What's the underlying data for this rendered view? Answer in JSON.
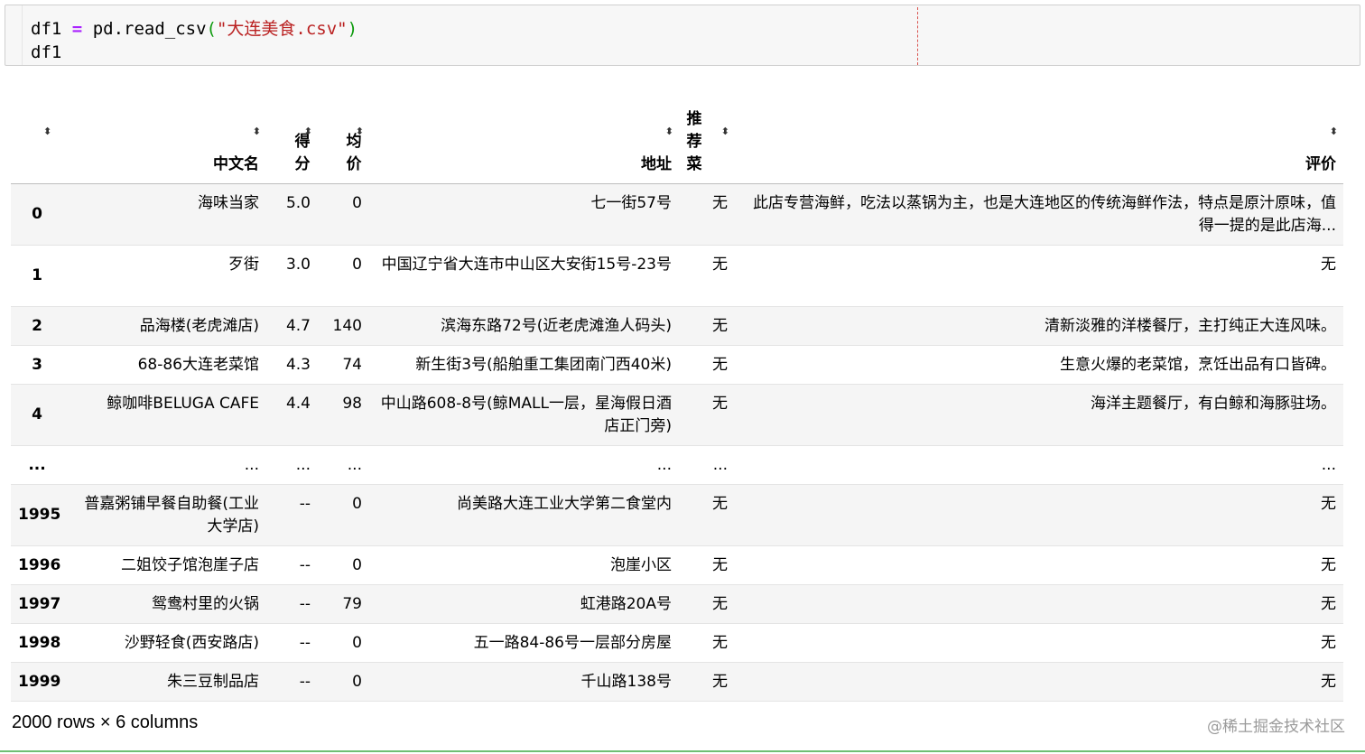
{
  "code_cell": {
    "line1": {
      "var": "df1",
      "eq": "=",
      "call": "pd.read_csv",
      "open": "(",
      "arg": "\"大连美食.csv\"",
      "close": ")"
    },
    "line2": "df1"
  },
  "table": {
    "headers": {
      "name": "中文名",
      "score": [
        "得",
        "分"
      ],
      "price": [
        "均",
        "价"
      ],
      "address": "地址",
      "recommend": [
        "推",
        "荐",
        "菜"
      ],
      "review": "评价"
    },
    "sort_icon": "⬍",
    "rows": [
      {
        "index": "0",
        "name": "海味当家",
        "score": "5.0",
        "price": "0",
        "address": "七一街57号",
        "recommend": "无",
        "review": "此店专营海鲜，吃法以蒸锅为主，也是大连地区的传统海鲜作法，特点是原汁原味，值得一提的是此店海..."
      },
      {
        "index": "1",
        "name": "歹街",
        "score": "3.0",
        "price": "0",
        "address": "中国辽宁省大连市中山区大安街15号-23号",
        "recommend": "无",
        "review": "无"
      },
      {
        "index": "2",
        "name": "品海楼(老虎滩店)",
        "score": "4.7",
        "price": "140",
        "address": "滨海东路72号(近老虎滩渔人码头)",
        "recommend": "无",
        "review": "清新淡雅的洋楼餐厅，主打纯正大连风味。"
      },
      {
        "index": "3",
        "name": "68-86大连老菜馆",
        "score": "4.3",
        "price": "74",
        "address": "新生街3号(船舶重工集团南门西40米)",
        "recommend": "无",
        "review": "生意火爆的老菜馆，烹饪出品有口皆碑。"
      },
      {
        "index": "4",
        "name": "鲸咖啡BELUGA CAFE",
        "score": "4.4",
        "price": "98",
        "address": "中山路608-8号(鲸MALL一层，星海假日酒店正门旁)",
        "recommend": "无",
        "review": "海洋主题餐厅，有白鲸和海豚驻场。"
      },
      {
        "index": "...",
        "name": "...",
        "score": "...",
        "price": "...",
        "address": "...",
        "recommend": "...",
        "review": "..."
      },
      {
        "index": "1995",
        "name": "普嘉粥铺早餐自助餐(工业大学店)",
        "score": "--",
        "price": "0",
        "address": "尚美路大连工业大学第二食堂内",
        "recommend": "无",
        "review": "无"
      },
      {
        "index": "1996",
        "name": "二姐饺子馆泡崖子店",
        "score": "--",
        "price": "0",
        "address": "泡崖小区",
        "recommend": "无",
        "review": "无"
      },
      {
        "index": "1997",
        "name": "鸳鸯村里的火锅",
        "score": "--",
        "price": "79",
        "address": "虹港路20A号",
        "recommend": "无",
        "review": "无"
      },
      {
        "index": "1998",
        "name": "沙野轻食(西安路店)",
        "score": "--",
        "price": "0",
        "address": "五一路84-86号一层部分房屋",
        "recommend": "无",
        "review": "无"
      },
      {
        "index": "1999",
        "name": "朱三豆制品店",
        "score": "--",
        "price": "0",
        "address": "千山路138号",
        "recommend": "无",
        "review": "无"
      }
    ]
  },
  "footer": {
    "rows_info": "2000 rows × 6 columns",
    "watermark": "@稀土掘金技术社区"
  },
  "colors": {
    "string": "#ba2121",
    "operator": "#aa22ff",
    "paren": "#0c9a0c",
    "ruler": "#d9534f",
    "row_stripe": "#f5f5f5",
    "cell_border_active": "#6fbf73"
  }
}
